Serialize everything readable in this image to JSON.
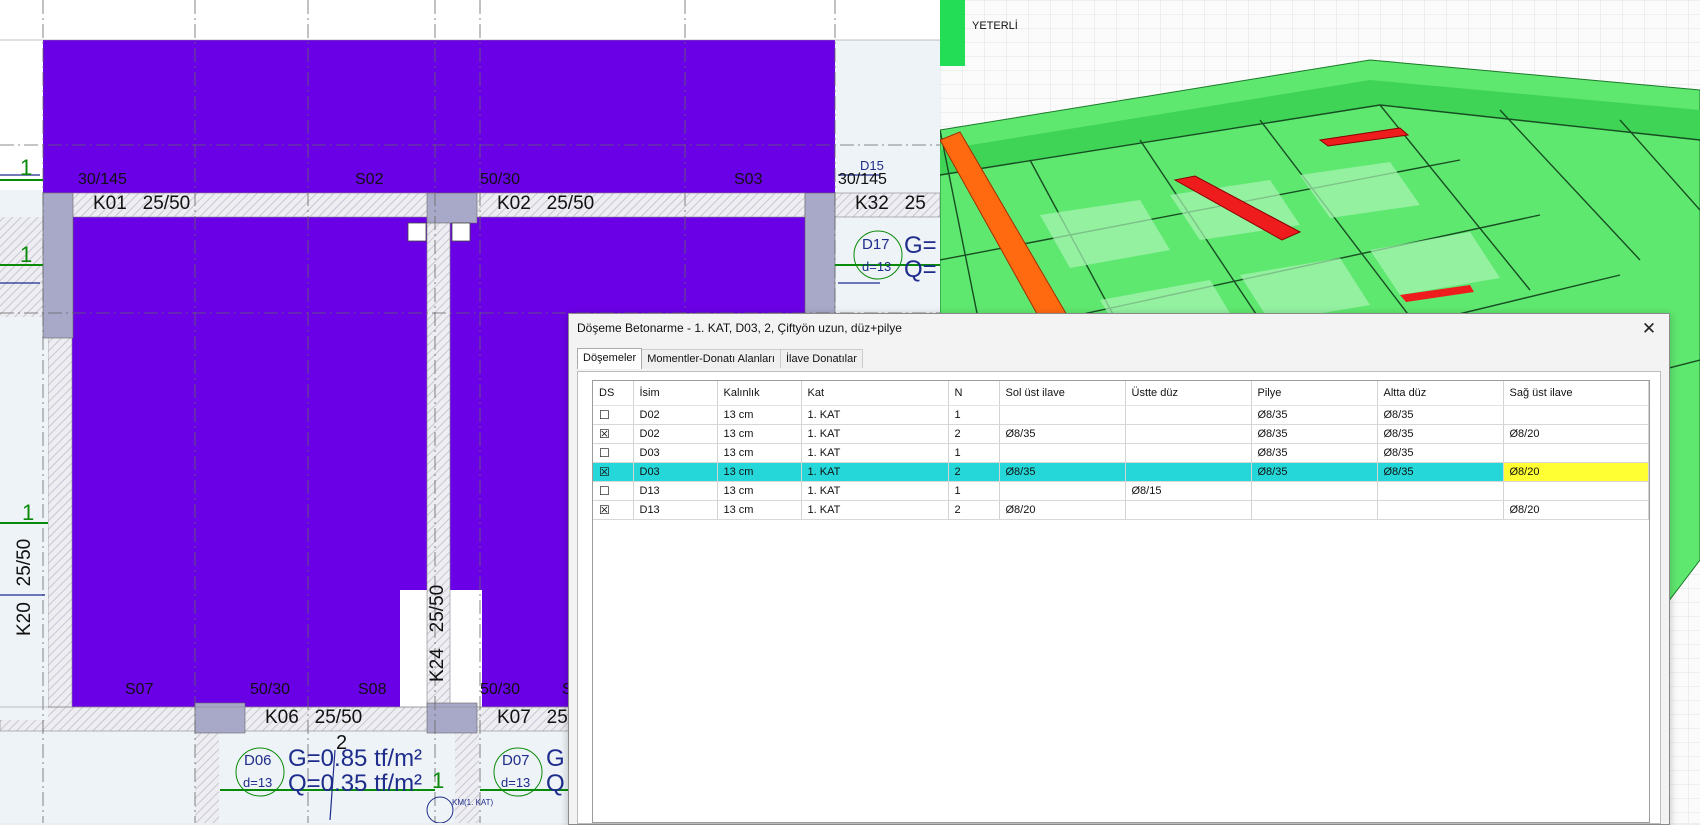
{
  "plan": {
    "beams": [
      {
        "id": "K01",
        "size": "25/50"
      },
      {
        "id": "K02",
        "size": "25/50"
      },
      {
        "id": "K32",
        "size": "25"
      },
      {
        "id": "K06",
        "size": "25/50"
      },
      {
        "id": "K07",
        "size": "25"
      },
      {
        "id": "K20",
        "size": "25/50"
      },
      {
        "id": "K24",
        "size": "25/50"
      }
    ],
    "columns": [
      "30/145",
      "50/30",
      "30/145",
      "50/30",
      "50/30"
    ],
    "slab_labels": [
      "S02",
      "S03",
      "S07",
      "S08",
      "S"
    ],
    "dims": [
      "1",
      "1",
      "1",
      "1",
      "2",
      "1"
    ],
    "d15": "D15",
    "d17": {
      "name": "D17",
      "thk": "d=13",
      "g": "G=",
      "q": "Q="
    },
    "d06": {
      "name": "D06",
      "thk": "d=13",
      "g": "G=0.85 tf/m²",
      "q": "Q=0.35 tf/m²"
    },
    "d07": {
      "name": "D07",
      "thk": "d=13",
      "g": "G",
      "q": "Q"
    },
    "km_label": "KM(1. KAT)"
  },
  "view3d": {
    "status": "YETERLİ",
    "status_color": "#22dd55"
  },
  "dialog": {
    "title": "Döşeme Betonarme - 1. KAT, D03, 2, Çiftyön uzun, düz+pilye",
    "close": "✕",
    "tabs": [
      "Döşemeler",
      "Momentler-Donatı Alanları",
      "İlave Donatılar"
    ],
    "active_tab": 0,
    "columns": [
      "DS",
      "İsim",
      "Kalınlık",
      "Kat",
      "N",
      "Sol üst ilave",
      "Üstte düz",
      "Pilye",
      "Altta düz",
      "Sağ üst ilave"
    ],
    "rows": [
      {
        "ds": "☐",
        "name": "D02",
        "thk": "13 cm",
        "floor": "1. KAT",
        "n": "1",
        "sol": "",
        "ustte": "",
        "pilye": "Ø8/35",
        "altta": "Ø8/35",
        "sag": ""
      },
      {
        "ds": "☒",
        "name": "D02",
        "thk": "13 cm",
        "floor": "1. KAT",
        "n": "2",
        "sol": "Ø8/35",
        "ustte": "",
        "pilye": "Ø8/35",
        "altta": "Ø8/35",
        "sag": "Ø8/20"
      },
      {
        "ds": "☐",
        "name": "D03",
        "thk": "13 cm",
        "floor": "1. KAT",
        "n": "1",
        "sol": "",
        "ustte": "",
        "pilye": "Ø8/35",
        "altta": "Ø8/35",
        "sag": ""
      },
      {
        "ds": "☒",
        "name": "D03",
        "thk": "13 cm",
        "floor": "1. KAT",
        "n": "2",
        "sol": "Ø8/35",
        "ustte": "",
        "pilye": "Ø8/35",
        "altta": "Ø8/35",
        "sag": "Ø8/20",
        "selected": true
      },
      {
        "ds": "☐",
        "name": "D13",
        "thk": "13 cm",
        "floor": "1. KAT",
        "n": "1",
        "sol": "",
        "ustte": "Ø8/15",
        "pilye": "",
        "altta": "",
        "sag": ""
      },
      {
        "ds": "☒",
        "name": "D13",
        "thk": "13 cm",
        "floor": "1. KAT",
        "n": "2",
        "sol": "Ø8/20",
        "ustte": "",
        "pilye": "",
        "altta": "",
        "sag": "Ø8/20"
      }
    ],
    "colors": {
      "selected_row": "#26d7d9",
      "highlight_cell": "#ffff33"
    }
  },
  "colors": {
    "slab": "#6a00e6",
    "beam": "#e6e6ea",
    "column": "#a8a8c8",
    "load_text": "#1e2c8c",
    "dim_green": "#0a8a0a"
  }
}
